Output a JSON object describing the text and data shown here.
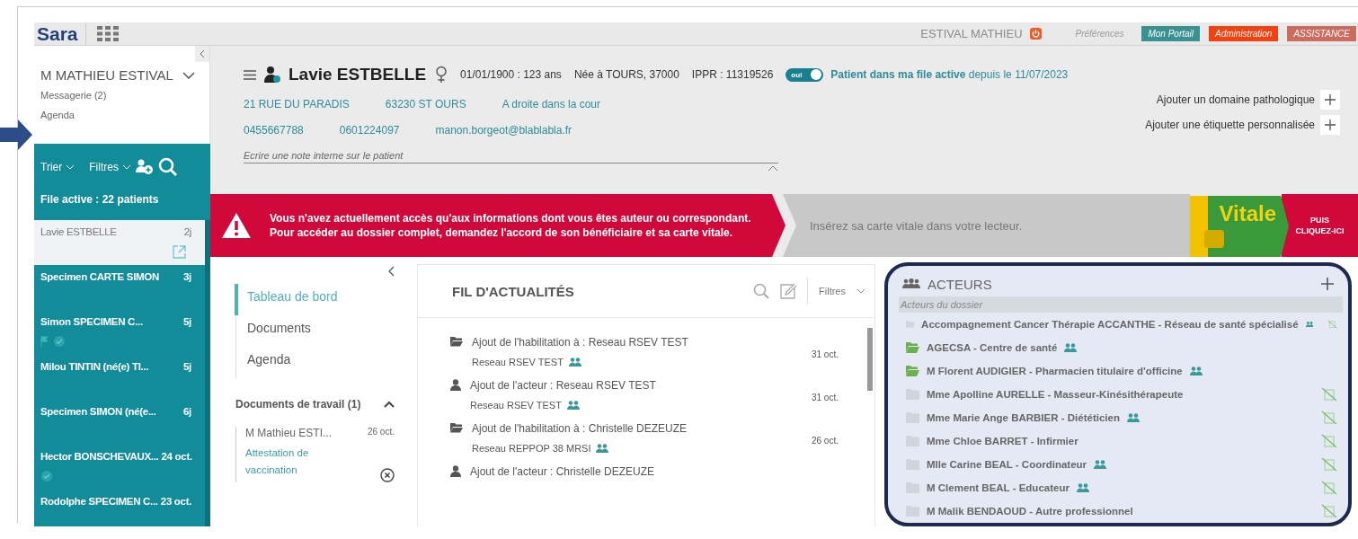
{
  "top_bar": {
    "logo": "Sara",
    "user": "ESTIVAL MATHIEU",
    "preferences": "Préférences",
    "buttons": [
      {
        "label": "Mon Portail",
        "color": "#3a9191"
      },
      {
        "label": "Administration",
        "color": "#f5400f"
      },
      {
        "label": "ASSISTANCE",
        "color": "#cd6b5f"
      }
    ]
  },
  "sidebar": {
    "user_name": "M MATHIEU ESTIVAL",
    "links": [
      "Messagerie (2)",
      "Agenda"
    ],
    "sort_label": "Trier",
    "filter_label": "Filtres",
    "active_count": "File active : 22 patients",
    "patients": [
      {
        "name": "Lavie ESTBELLE",
        "age": "2j",
        "selected": true,
        "flagged": false,
        "checked": false
      },
      {
        "name": "Specimen CARTE SIMON",
        "age": "3j",
        "selected": false,
        "flagged": false,
        "checked": false
      },
      {
        "name": "Simon SPECIMEN C...",
        "age": "5j",
        "selected": false,
        "flagged": true,
        "checked": true
      },
      {
        "name": "Milou TINTIN (né(e) TI...",
        "age": "5j",
        "selected": false,
        "flagged": false,
        "checked": false
      },
      {
        "name": "Specimen SIMON (né(e...",
        "age": "6j",
        "selected": false,
        "flagged": false,
        "checked": false
      },
      {
        "name": "Hector BONSCHEVAUX...",
        "age": "24 oct.",
        "selected": false,
        "flagged": false,
        "checked": true
      },
      {
        "name": "Rodolphe SPECIMEN C...",
        "age": "23 oct.",
        "selected": false,
        "flagged": false,
        "checked": false
      }
    ]
  },
  "patient": {
    "name": "Lavie ESTBELLE",
    "birth": "01/01/1900 : 123 ans",
    "birthplace": "Née à TOURS, 37000",
    "ippr": "IPPR : 11319526",
    "active_toggle": {
      "label": "oui",
      "on": true
    },
    "active_text": "**Patient dans ma file active** depuis le 11/07/2023",
    "address": [
      "21 RUE DU PARADIS",
      "63230 ST OURS",
      "A droite dans la cour"
    ],
    "contacts": [
      "0455667788",
      "0601224097",
      "manon.borgeot@blablabla.fr"
    ],
    "note_placeholder": "Ecrire une note interne sur le patient",
    "add_actions": [
      "Ajouter un domaine pathologique",
      "Ajouter une étiquette personnalisée"
    ]
  },
  "banner": {
    "warning": "Vous n'avez actuellement accès qu'aux informations dont vous êtes auteur ou correspondant.\nPour accéder au dossier complet, demandez l'accord de son bénéficiaire et sa carte vitale.",
    "card_prompt": "Insérez sa carte vitale dans votre lecteur.",
    "card_label": "Vitale",
    "action": "PUIS\nCLIQUEZ-ICI"
  },
  "nav": {
    "items": [
      {
        "label": "Tableau de bord",
        "selected": true
      },
      {
        "label": "Documents",
        "selected": false
      },
      {
        "label": "Agenda",
        "selected": false
      }
    ],
    "work_docs": {
      "title": "Documents de travail (1)",
      "expanded": true,
      "docs": [
        {
          "author": "M Mathieu ESTI...",
          "date": "26 oct.",
          "title": "Attestation de vaccination"
        }
      ]
    }
  },
  "feed": {
    "title": "FIL D'ACTUALITÉS",
    "filter_label": "Filtres",
    "items": [
      {
        "kind": "habilitation",
        "title": "Ajout de l'habilitation à : Reseau RSEV TEST",
        "subtitle": "Reseau RSEV TEST",
        "date": "31 oct."
      },
      {
        "kind": "actor",
        "title": "Ajout de l'acteur : Reseau RSEV TEST",
        "subtitle": "Reseau RSEV TEST",
        "date": "31 oct."
      },
      {
        "kind": "habilitation",
        "title": "Ajout de l'habilitation à : Christelle DEZEUZE",
        "subtitle": "Reseau REPPOP 38 MRSI",
        "date": "26 oct."
      },
      {
        "kind": "actor",
        "title": "Ajout de l'acteur : Christelle DEZEUZE"
      }
    ]
  },
  "actors": {
    "title": "ACTEURS",
    "subtitle": "Acteurs du dossier",
    "items": [
      {
        "name": "Accompagnement Cancer Thérapie ACCANTHE - Réseau de santé spécialisé",
        "shared": false,
        "team": true,
        "no_access": true
      },
      {
        "name": "AGECSA - Centre de santé",
        "shared": true,
        "team": true,
        "no_access": false
      },
      {
        "name": "M Florent AUDIGIER - Pharmacien titulaire d'officine",
        "shared": true,
        "team": true,
        "no_access": false
      },
      {
        "name": "Mme Apolline AURELLE - Masseur-Kinésithérapeute",
        "shared": false,
        "team": false,
        "no_access": true
      },
      {
        "name": "Mme Marie Ange BARBIER - Diététicien",
        "shared": false,
        "team": true,
        "no_access": true
      },
      {
        "name": "Mme Chloe BARRET - Infirmier",
        "shared": false,
        "team": false,
        "no_access": true
      },
      {
        "name": "Mlle Carine BEAL - Coordinateur",
        "shared": false,
        "team": true,
        "no_access": true
      },
      {
        "name": "M Clement BEAL - Educateur",
        "shared": false,
        "team": true,
        "no_access": true
      },
      {
        "name": "M Malik BENDAOUD - Autre professionnel",
        "shared": false,
        "team": false,
        "no_access": true
      }
    ]
  }
}
